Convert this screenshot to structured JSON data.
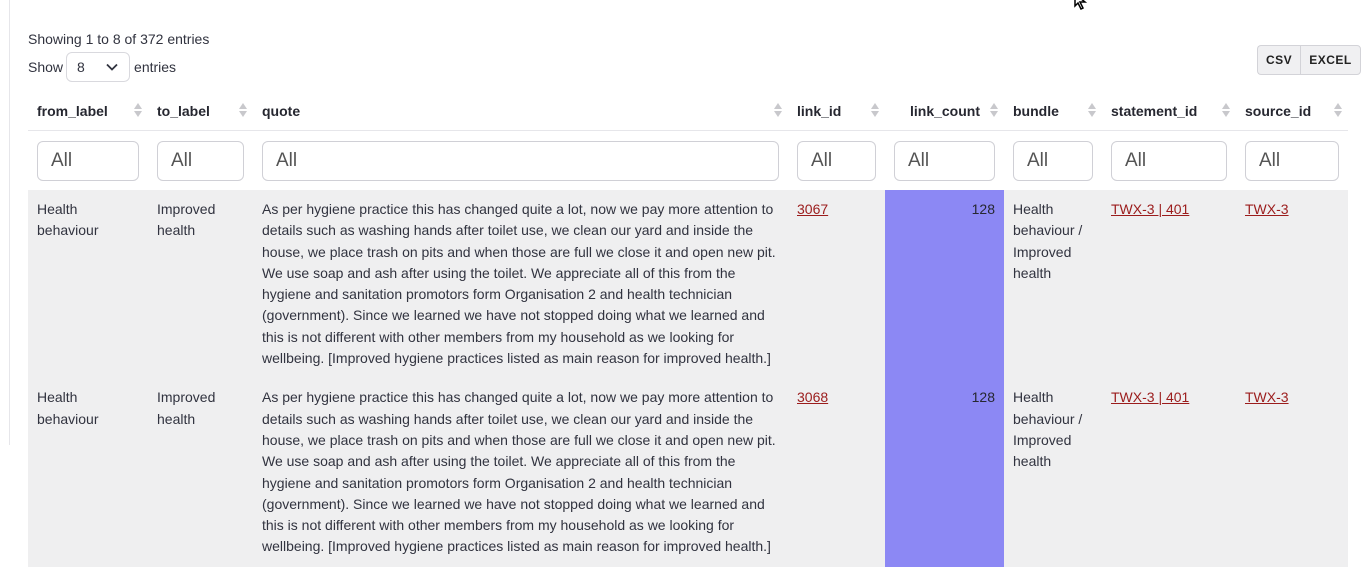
{
  "info_text": "Showing 1 to 8 of 372 entries",
  "length_control": {
    "show_label": "Show",
    "selected": "8",
    "entries_label": "entries"
  },
  "export_buttons": {
    "csv": "CSV",
    "excel": "EXCEL"
  },
  "columns": [
    "from_label",
    "to_label",
    "quote",
    "link_id",
    "link_count",
    "bundle",
    "statement_id",
    "source_id"
  ],
  "filter_placeholder": "All",
  "rows": [
    {
      "from_label": "Health behaviour",
      "to_label": "Improved health",
      "quote": "As per hygiene practice this has changed quite a lot, now we pay more attention to details such as washing hands after toilet use, we clean our yard and inside the house, we place trash on pits and when those are full we close it and open new pit. We use soap and ash after using the toilet. We appreciate all of this from the hygiene and sanitation promotors form Organisation 2 and health technician (government). Since we learned we have not stopped doing what we learned and this is not different with other members from my household as we looking for wellbeing. [Improved hygiene practices listed as main reason for improved health.]",
      "link_id": "3067",
      "link_count": "128",
      "bundle": "Health behaviour / Improved health",
      "statement_id": "TWX-3 | 401",
      "source_id": "TWX-3"
    },
    {
      "from_label": "Health behaviour",
      "to_label": "Improved health",
      "quote": "As per hygiene practice this has changed quite a lot, now we pay more attention to details such as washing hands after toilet use, we clean our yard and inside the house, we place trash on pits and when those are full we close it and open new pit. We use soap and ash after using the toilet. We appreciate all of this from the hygiene and sanitation promotors form Organisation 2 and health technician (government). Since we learned we have not stopped doing what we learned and this is not different with other members from my household as we looking for wellbeing. [Improved hygiene practices listed as main reason for improved health.]",
      "link_id": "3068",
      "link_count": "128",
      "bundle": "Health behaviour / Improved health",
      "statement_id": "TWX-3 | 401",
      "source_id": "TWX-3"
    }
  ],
  "colors": {
    "link": "#9b1c1c",
    "count_bar": "#8c88f4",
    "row_bg": "#efeff0"
  }
}
